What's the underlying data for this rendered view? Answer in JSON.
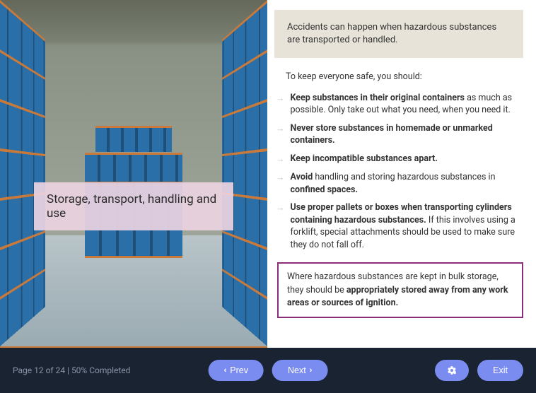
{
  "left": {
    "title": "Storage, transport, handling and use"
  },
  "content": {
    "callout_top": "Accidents can happen when hazardous substances are transported or handled.",
    "intro": "To keep everyone safe, you should:",
    "bullets": [
      {
        "bold_a": "Keep substances in their original containers",
        "rest_a": " as much as possible. Only take out what you need, when you need it."
      },
      {
        "bold_a": "Never store substances in homemade or unmarked containers."
      },
      {
        "bold_a": "Keep incompatible substances apart."
      },
      {
        "bold_a": "Avoid",
        "rest_a": " handling and storing hazardous substances in ",
        "bold_b": "confined spaces."
      },
      {
        "bold_a": "Use proper pallets or boxes when transporting cylinders containing hazardous substances.",
        "rest_a": " If this involves using a forklift, special attachments should be used to make sure they do not fall off."
      }
    ],
    "note_pre": "Where hazardous substances are kept in bulk storage, they should be ",
    "note_bold": "appropriately stored away from any work areas or sources of ignition."
  },
  "footer": {
    "status": "Page 12 of 24 | 50% Completed",
    "prev": "Prev",
    "next": "Next",
    "exit": "Exit"
  }
}
